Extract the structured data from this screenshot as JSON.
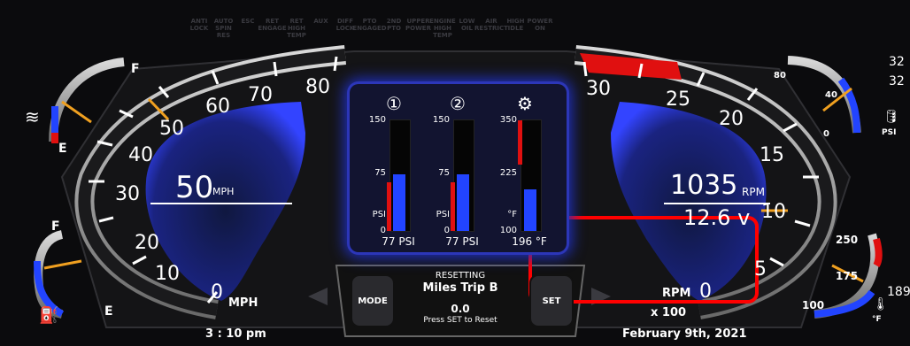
{
  "indicators": [
    {
      "label": "ANTI\nLOCK"
    },
    {
      "label": "AUTO\nSPIN\nRES"
    },
    {
      "label": "ESC"
    },
    {
      "label": "RET\nENGAGE"
    },
    {
      "label": "RET\nHIGH\nTEMP"
    },
    {
      "label": "AUX"
    },
    {
      "label": "DIFF\nLOCK"
    },
    {
      "label": "PTO\nENGAGED"
    },
    {
      "label": "2ND\nPTO"
    },
    {
      "label": "UPPER\nPOWER"
    },
    {
      "label": "ENGINE\nHIGH\nTEMP"
    },
    {
      "label": "LOW\nOIL"
    },
    {
      "label": "AIR\nRESTRICT"
    },
    {
      "label": "HIGH\nIDLE"
    },
    {
      "label": "POWER\nON"
    }
  ],
  "speedometer": {
    "ticks": [
      "0",
      "10",
      "20",
      "30",
      "40",
      "50",
      "60",
      "70",
      "80"
    ],
    "value": "50",
    "unit_small": "MPH",
    "unit_label": "MPH"
  },
  "tachometer": {
    "ticks": [
      "30",
      "25",
      "20",
      "15",
      "10",
      "5",
      "0"
    ],
    "rpm_value": "1035",
    "rpm_unit": "RPM",
    "voltage": "12.6 v",
    "rpm_label": "RPM",
    "multiplier": "x 100"
  },
  "center_gauges": [
    {
      "icon": "①",
      "top": "150",
      "mid": "75",
      "unit": "PSI",
      "bottom": "0",
      "reading": "77 PSI",
      "fill_fraction": 0.51
    },
    {
      "icon": "②",
      "top": "150",
      "mid": "75",
      "unit": "PSI",
      "bottom": "0",
      "reading": "77 PSI",
      "fill_fraction": 0.51
    },
    {
      "icon": "⚙",
      "top": "350",
      "mid": "225",
      "unit": "°F",
      "bottom": "100",
      "reading": "196 °F",
      "fill_fraction": 0.38
    }
  ],
  "left_fuel_gauge": {
    "full": "F",
    "empty": "E"
  },
  "left_def_gauge": {
    "full": "F",
    "empty": "E"
  },
  "right_oil_gauge": {
    "ticks": [
      "80",
      "40",
      "0"
    ],
    "unit": "PSI",
    "readout_a": "32",
    "readout_b": "32"
  },
  "right_temp_gauge": {
    "ticks": [
      "250",
      "175",
      "100"
    ],
    "unit": "°F",
    "readout": "189"
  },
  "trip": {
    "status": "RESETTING",
    "name": "Miles Trip B",
    "value": "0.0",
    "hint": "Press SET to Reset",
    "mode_label": "MODE",
    "set_label": "SET"
  },
  "footer": {
    "time": "3 : 10 pm",
    "date": "February 9th, 2021"
  },
  "colors": {
    "accent_blue": "#2244ff",
    "redline": "#e01010",
    "needle": "#f0a020",
    "highlight_box": "#ff0000"
  }
}
